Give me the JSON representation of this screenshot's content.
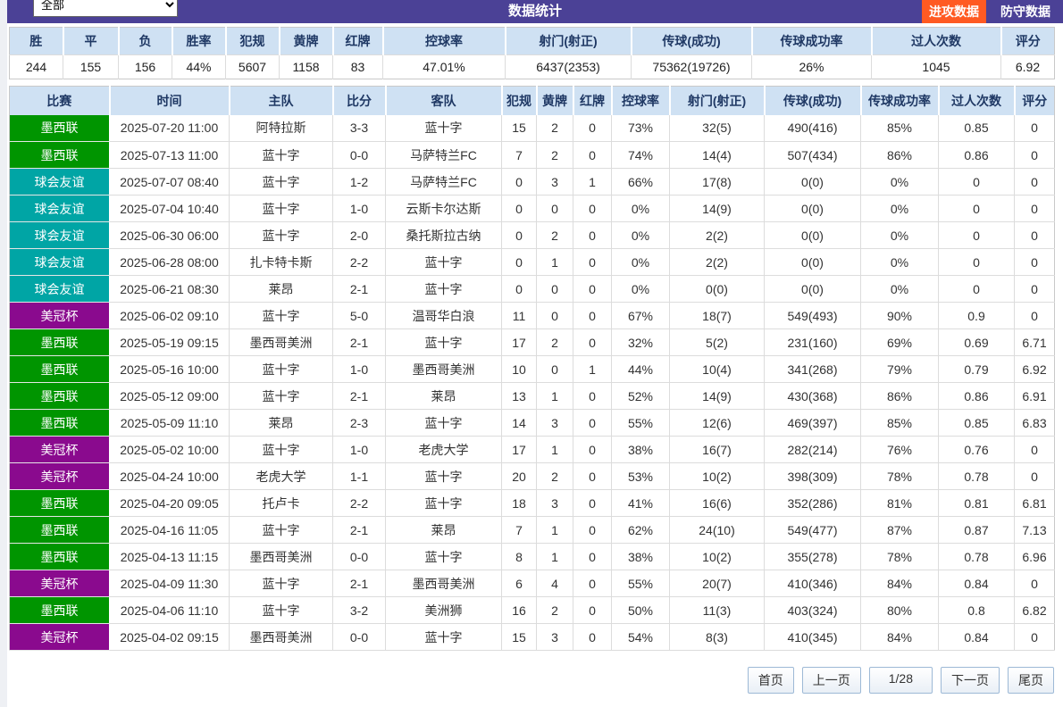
{
  "colors": {
    "topbar": "#4b4196",
    "attack_button": "#ff5a22",
    "header_bg": "#cfe1f3",
    "header_text": "#1f3864",
    "league_mexican": "#009500",
    "league_friendly": "#00a5a5",
    "league_cup": "#8a0a8e"
  },
  "topbar": {
    "filter_value": "全部",
    "title": "数据统计",
    "attack_button": "进攻数据",
    "defense_button": "防守数据"
  },
  "summary": {
    "headers": [
      "胜",
      "平",
      "负",
      "胜率",
      "犯规",
      "黄牌",
      "红牌",
      "控球率",
      "射门(射正)",
      "传球(成功)",
      "传球成功率",
      "过人次数",
      "评分"
    ],
    "values": [
      "244",
      "155",
      "156",
      "44%",
      "5607",
      "1158",
      "83",
      "47.01%",
      "6437(2353)",
      "75362(19726)",
      "26%",
      "1045",
      "6.92"
    ]
  },
  "matches": {
    "headers": [
      "比赛",
      "时间",
      "主队",
      "比分",
      "客队",
      "犯规",
      "黄牌",
      "红牌",
      "控球率",
      "射门(射正)",
      "传球(成功)",
      "传球成功率",
      "过人次数",
      "评分"
    ],
    "league_colors": {
      "墨西联": "#009500",
      "球会友谊": "#00a5a5",
      "美冠杯": "#8a0a8e"
    },
    "rows": [
      [
        "墨西联",
        "2025-07-20 11:00",
        "阿特拉斯",
        "3-3",
        "蓝十字",
        "15",
        "2",
        "0",
        "73%",
        "32(5)",
        "490(416)",
        "85%",
        "0.85",
        "0"
      ],
      [
        "墨西联",
        "2025-07-13 11:00",
        "蓝十字",
        "0-0",
        "马萨特兰FC",
        "7",
        "2",
        "0",
        "74%",
        "14(4)",
        "507(434)",
        "86%",
        "0.86",
        "0"
      ],
      [
        "球会友谊",
        "2025-07-07 08:40",
        "蓝十字",
        "1-2",
        "马萨特兰FC",
        "0",
        "3",
        "1",
        "66%",
        "17(8)",
        "0(0)",
        "0%",
        "0",
        "0"
      ],
      [
        "球会友谊",
        "2025-07-04 10:40",
        "蓝十字",
        "1-0",
        "云斯卡尔达斯",
        "0",
        "0",
        "0",
        "0%",
        "14(9)",
        "0(0)",
        "0%",
        "0",
        "0"
      ],
      [
        "球会友谊",
        "2025-06-30 06:00",
        "蓝十字",
        "2-0",
        "桑托斯拉古纳",
        "0",
        "2",
        "0",
        "0%",
        "2(2)",
        "0(0)",
        "0%",
        "0",
        "0"
      ],
      [
        "球会友谊",
        "2025-06-28 08:00",
        "扎卡特卡斯",
        "2-2",
        "蓝十字",
        "0",
        "1",
        "0",
        "0%",
        "2(2)",
        "0(0)",
        "0%",
        "0",
        "0"
      ],
      [
        "球会友谊",
        "2025-06-21 08:30",
        "莱昂",
        "2-1",
        "蓝十字",
        "0",
        "0",
        "0",
        "0%",
        "0(0)",
        "0(0)",
        "0%",
        "0",
        "0"
      ],
      [
        "美冠杯",
        "2025-06-02 09:10",
        "蓝十字",
        "5-0",
        "温哥华白浪",
        "11",
        "0",
        "0",
        "67%",
        "18(7)",
        "549(493)",
        "90%",
        "0.9",
        "0"
      ],
      [
        "墨西联",
        "2025-05-19 09:15",
        "墨西哥美洲",
        "2-1",
        "蓝十字",
        "17",
        "2",
        "0",
        "32%",
        "5(2)",
        "231(160)",
        "69%",
        "0.69",
        "6.71"
      ],
      [
        "墨西联",
        "2025-05-16 10:00",
        "蓝十字",
        "1-0",
        "墨西哥美洲",
        "10",
        "0",
        "1",
        "44%",
        "10(4)",
        "341(268)",
        "79%",
        "0.79",
        "6.92"
      ],
      [
        "墨西联",
        "2025-05-12 09:00",
        "蓝十字",
        "2-1",
        "莱昂",
        "13",
        "1",
        "0",
        "52%",
        "14(9)",
        "430(368)",
        "86%",
        "0.86",
        "6.91"
      ],
      [
        "墨西联",
        "2025-05-09 11:10",
        "莱昂",
        "2-3",
        "蓝十字",
        "14",
        "3",
        "0",
        "55%",
        "12(6)",
        "469(397)",
        "85%",
        "0.85",
        "6.83"
      ],
      [
        "美冠杯",
        "2025-05-02 10:00",
        "蓝十字",
        "1-0",
        "老虎大学",
        "17",
        "1",
        "0",
        "38%",
        "16(7)",
        "282(214)",
        "76%",
        "0.76",
        "0"
      ],
      [
        "美冠杯",
        "2025-04-24 10:00",
        "老虎大学",
        "1-1",
        "蓝十字",
        "20",
        "2",
        "0",
        "53%",
        "10(2)",
        "398(309)",
        "78%",
        "0.78",
        "0"
      ],
      [
        "墨西联",
        "2025-04-20 09:05",
        "托卢卡",
        "2-2",
        "蓝十字",
        "18",
        "3",
        "0",
        "41%",
        "16(6)",
        "352(286)",
        "81%",
        "0.81",
        "6.81"
      ],
      [
        "墨西联",
        "2025-04-16 11:05",
        "蓝十字",
        "2-1",
        "莱昂",
        "7",
        "1",
        "0",
        "62%",
        "24(10)",
        "549(477)",
        "87%",
        "0.87",
        "7.13"
      ],
      [
        "墨西联",
        "2025-04-13 11:15",
        "墨西哥美洲",
        "0-0",
        "蓝十字",
        "8",
        "1",
        "0",
        "38%",
        "10(2)",
        "355(278)",
        "78%",
        "0.78",
        "6.96"
      ],
      [
        "美冠杯",
        "2025-04-09 11:30",
        "蓝十字",
        "2-1",
        "墨西哥美洲",
        "6",
        "4",
        "0",
        "55%",
        "20(7)",
        "410(346)",
        "84%",
        "0.84",
        "0"
      ],
      [
        "墨西联",
        "2025-04-06 11:10",
        "蓝十字",
        "3-2",
        "美洲狮",
        "16",
        "2",
        "0",
        "50%",
        "11(3)",
        "403(324)",
        "80%",
        "0.8",
        "6.82"
      ],
      [
        "美冠杯",
        "2025-04-02 09:15",
        "墨西哥美洲",
        "0-0",
        "蓝十字",
        "15",
        "3",
        "0",
        "54%",
        "8(3)",
        "410(345)",
        "84%",
        "0.84",
        "0"
      ]
    ]
  },
  "pagination": {
    "first": "首页",
    "prev": "上一页",
    "page": "1/28",
    "next": "下一页",
    "last": "尾页"
  }
}
